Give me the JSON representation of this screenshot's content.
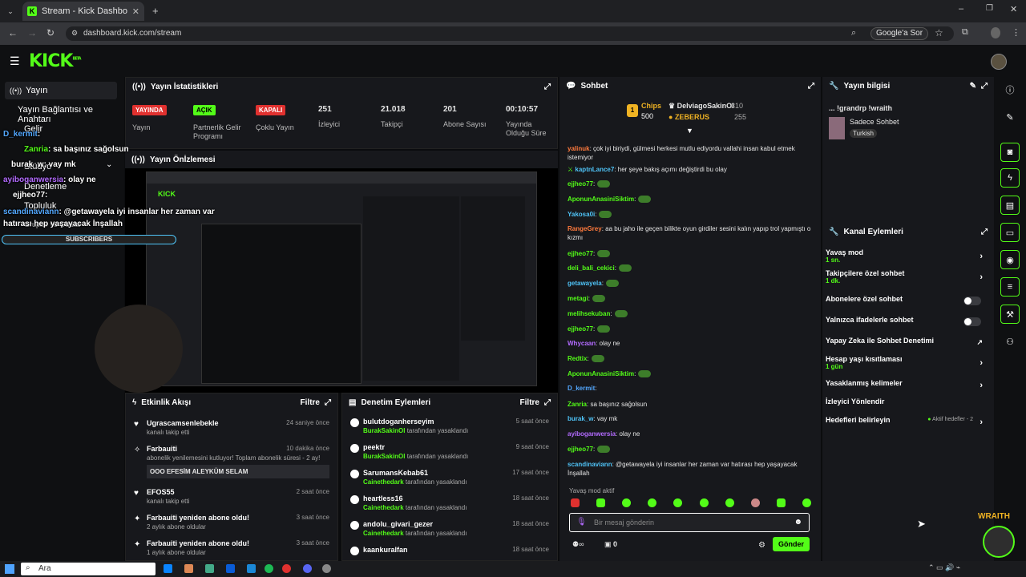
{
  "browser": {
    "tab_title": "Stream - Kick Dashboard",
    "url": "dashboard.kick.com/stream",
    "google_btn": "Google'a Sor"
  },
  "brand": {
    "logo": "KICK",
    "beta": "BETA"
  },
  "nav": {
    "items": [
      "Yayın",
      "Yayın Bağlantısı ve Anahtarı",
      "Gelir",
      "Stüdyo",
      "Denetleme",
      "Topluluk",
      "Gruplar ve Odalar"
    ]
  },
  "stats": {
    "title": "Yayın İstatistikleri",
    "items": [
      {
        "badge": "YAYINDA",
        "label": "Yayın",
        "badge_color": "#e0312f"
      },
      {
        "badge": "AÇIK",
        "label": "Partnerlik Gelir Programı",
        "badge_color": "#53fc18"
      },
      {
        "badge": "KAPALI",
        "label": "Çoklu Yayın",
        "badge_color": "#e0312f"
      },
      {
        "value": "251",
        "label": "İzleyici"
      },
      {
        "value": "21.018",
        "label": "Takipçi"
      },
      {
        "value": "201",
        "label": "Abone Sayısı"
      },
      {
        "value": "00:10:57",
        "label": "Yayında Olduğu Süre"
      }
    ]
  },
  "preview": {
    "title": "Yayın Önİzlemesi"
  },
  "overlay": {
    "lines": [
      {
        "user": "D_kermit",
        "text": ":",
        "ucolor": "#53a8ff"
      },
      {
        "user": "Zanria",
        "text": ": sa başınız sağolsun",
        "ucolor": "#53fc18"
      },
      {
        "user": "burak_w",
        "text": ": vay mk",
        "ucolor": "#fff"
      },
      {
        "user": "ayiboganwersia",
        "text": ": olay ne",
        "ucolor": "#b36bff"
      },
      {
        "user": "ejjheo77",
        "text": ":",
        "ucolor": "#fff"
      },
      {
        "user": "scandinaviann",
        "text": ": @getawayela iyi insanlar her zaman var hatırası hep yaşayacak İnşallah",
        "ucolor": "#53a8ff"
      }
    ],
    "subscribers": "SUBSCRIBERS"
  },
  "activity": {
    "title": "Etkinlik Akışı",
    "filter": "Filtre",
    "items": [
      {
        "name": "Ugrascamsenlebekle",
        "sub": "kanalı takip etti",
        "time": "24 saniye önce"
      },
      {
        "name": "Farbauiti",
        "sub": "abonelik yenilemesini kutluyor! Toplam abonelik süresi - 2 ay!",
        "time": "10 dakika önce",
        "note": "OOO EFESİM ALEYKÜM SELAM"
      },
      {
        "name": "EFOS55",
        "sub": "kanalı takip etti",
        "time": "2 saat önce"
      },
      {
        "name": "Farbauiti yeniden abone oldu!",
        "sub": "2 aylık abone oldular",
        "time": "3 saat önce"
      },
      {
        "name": "Farbauiti yeniden abone oldu!",
        "sub": "1 aylık abone oldular",
        "time": "3 saat önce"
      }
    ]
  },
  "moderation": {
    "title": "Denetim Eylemleri",
    "filter": "Filtre",
    "items": [
      {
        "name": "bulutdoganherseyim",
        "mod": "BurakSakinOl",
        "sub": "tarafından yasaklandı",
        "time": "5 saat önce"
      },
      {
        "name": "peektr",
        "mod": "BurakSakinOl",
        "sub": "tarafından yasaklandı",
        "time": "9 saat önce"
      },
      {
        "name": "SarumansKebab61",
        "mod": "Cainethedark",
        "sub": "tarafından yasaklandı",
        "time": "17 saat önce"
      },
      {
        "name": "heartless16",
        "mod": "Cainethedark",
        "sub": "tarafından yasaklandı",
        "time": "18 saat önce"
      },
      {
        "name": "andolu_givari_gezer",
        "mod": "Cainethedark",
        "sub": "tarafından yasaklandı",
        "time": "18 saat önce"
      },
      {
        "name": "kaankuralfan",
        "time": "18 saat önce"
      }
    ]
  },
  "chat": {
    "title": "Sohbet",
    "chips_label": "Chips",
    "chips_value": "500",
    "leader1": "DelviagoSakinOl",
    "leader1_val": "310",
    "leader2": "ZEBERUS",
    "leader2_val": "255",
    "messages": [
      {
        "user": "yalinuk",
        "text": ": çok iyi biriydi, gülmesi herkesi mutlu ediyordu vallahi insan kabul etmek istemiyor",
        "ucolor": "#ff7a3d"
      },
      {
        "user": "kaptnLance7",
        "text": ": her şeye bakış açımı değiştirdi bu olay",
        "ucolor": "#4fc3f7"
      },
      {
        "user": "ejjheo77",
        "text": ":",
        "ucolor": "#53fc18"
      },
      {
        "user": "AponunAnasiniSiktim",
        "text": ":",
        "ucolor": "#53fc18"
      },
      {
        "user": "Yakosa0i",
        "text": ":",
        "ucolor": "#4fc3f7"
      },
      {
        "user": "RangeGrey",
        "text": ": aa bu jaho ile geçen bilikte oyun girdiler sesini kalın yapıp trol yapmıştı o kızmı",
        "ucolor": "#ff7a3d"
      },
      {
        "user": "ejjheo77",
        "text": ":",
        "ucolor": "#53fc18"
      },
      {
        "user": "deli_bali_cekici",
        "text": ":",
        "ucolor": "#53fc18"
      },
      {
        "user": "getawayela",
        "text": ":",
        "ucolor": "#4fc3f7"
      },
      {
        "user": "metagi",
        "text": ":",
        "ucolor": "#53fc18"
      },
      {
        "user": "melihsekuban",
        "text": ":",
        "ucolor": "#53fc18"
      },
      {
        "user": "ejjheo77",
        "text": ":",
        "ucolor": "#53fc18"
      },
      {
        "user": "Whycaan",
        "text": ": olay ne",
        "ucolor": "#b36bff"
      },
      {
        "user": "Redtix",
        "text": ":",
        "ucolor": "#53fc18"
      },
      {
        "user": "AponunAnasiniSiktim",
        "text": ":",
        "ucolor": "#53fc18"
      },
      {
        "user": "D_kermit",
        "text": ":",
        "ucolor": "#53a8ff"
      },
      {
        "user": "Zanria",
        "text": ": sa başınız sağolsun",
        "ucolor": "#53fc18"
      },
      {
        "user": "burak_w",
        "text": ": vay mk",
        "ucolor": "#4fc3f7"
      },
      {
        "user": "ayiboganwersia",
        "text": ": olay ne",
        "ucolor": "#b36bff"
      },
      {
        "user": "ejjheo77",
        "text": ":",
        "ucolor": "#53fc18"
      },
      {
        "user": "scandinaviann",
        "text": ": @getawayela iyi insanlar her zaman var hatırası hep yaşayacak İnşallah",
        "ucolor": "#4fc3f7"
      }
    ],
    "slow_mode": "Yavaş mod aktif",
    "placeholder": "Bir mesaj gönderin",
    "send": "Gönder",
    "count": "0"
  },
  "info": {
    "title": "Yayın bilgisi",
    "stream_title": "... !grandrp !wraith",
    "category": "Sadece Sohbet",
    "language": "Turkish"
  },
  "actions": {
    "title": "Kanal Eylemleri",
    "items": [
      {
        "label": "Yavaş mod",
        "sub": "1 sn.",
        "type": "chev"
      },
      {
        "label": "Takipçilere özel sohbet",
        "sub": "1 dk.",
        "type": "chev"
      },
      {
        "label": "Abonelere özel sohbet",
        "type": "toggle"
      },
      {
        "label": "Yalnızca ifadelerle sohbet",
        "type": "toggle"
      },
      {
        "label": "Yapay Zeka ile Sohbet Denetimi",
        "type": "ext"
      },
      {
        "label": "Hesap yaşı kısıtlaması",
        "sub": "1 gün",
        "type": "chev"
      },
      {
        "label": "Yasaklanmış kelimeler",
        "type": "chev"
      },
      {
        "label": "İzleyici Yönlendir",
        "type": "none"
      },
      {
        "label": "Hedefleri belirleyin",
        "note": "Aktif hedefler - 2",
        "type": "chev"
      }
    ]
  },
  "taskbar": {
    "search": "Ara"
  },
  "watermark": {
    "text": "WRAITH"
  }
}
